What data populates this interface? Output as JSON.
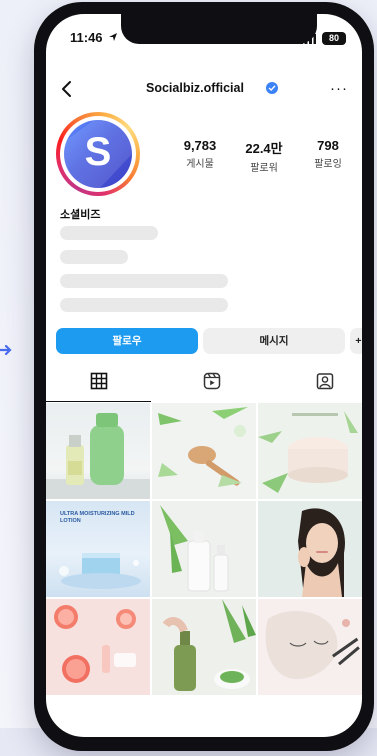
{
  "status_bar": {
    "time": "11:46",
    "battery": "80"
  },
  "header": {
    "username": "Socialbiz.official",
    "more": "···"
  },
  "profile": {
    "avatar_letter": "S",
    "display_name": "소셜비즈",
    "stats": [
      {
        "value": "9,783",
        "label": "게시물"
      },
      {
        "value": "22.4만",
        "label": "팔로워"
      },
      {
        "value": "798",
        "label": "팔로잉"
      }
    ]
  },
  "actions": {
    "follow": "팔로우",
    "message": "메시지",
    "add_person": "+👤"
  },
  "tabs": [
    {
      "icon": "grid-icon",
      "active": true
    },
    {
      "icon": "reels-icon",
      "active": false
    },
    {
      "icon": "tagged-icon",
      "active": false
    }
  ],
  "posts": [
    {
      "subject": "green lotion bottles"
    },
    {
      "subject": "aloe slices and wooden spoon"
    },
    {
      "subject": "aloe cream jar"
    },
    {
      "subject": "ultra moisturizing mild lotion",
      "caption": "ULTRA MOISTURIZING MILD LOTION"
    },
    {
      "subject": "white cosmetic bottles with leaves"
    },
    {
      "subject": "woman touching face"
    },
    {
      "subject": "grapefruit slices"
    },
    {
      "subject": "pump bottle and aloe"
    },
    {
      "subject": "sheet mask"
    }
  ],
  "colors": {
    "accent": "#1d9bf0",
    "verified": "#3b82f6"
  }
}
